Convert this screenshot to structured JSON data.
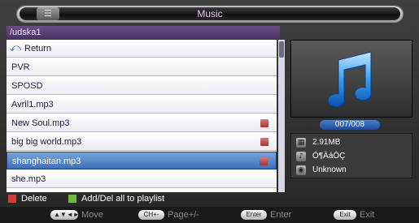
{
  "window": {
    "title": "Music",
    "menu_icon": "menu-icon"
  },
  "path": "/udska1",
  "files": [
    {
      "label": "Return",
      "icon": "return-icon"
    },
    {
      "label": "PVR"
    },
    {
      "label": "SPOSD"
    },
    {
      "label": "Avril1.mp3"
    },
    {
      "label": "New Soul.mp3",
      "marked": true
    },
    {
      "label": "big big world.mp3",
      "marked": true
    },
    {
      "label": "shanghaitan.mp3",
      "marked": true,
      "selected": true
    },
    {
      "label": "she.mp3"
    }
  ],
  "preview": {
    "icon": "music-note-icon",
    "counter": "007/008"
  },
  "info": {
    "size": "2.91MB",
    "artist": "Ó¶ÀáÒÇ",
    "album": "Unknown"
  },
  "legend": {
    "red_label": "Delete",
    "green_label": "Add/Del all to playlist",
    "red_color": "#d83a3a",
    "green_color": "#6dbb3a"
  },
  "hints": [
    {
      "key": "▲▼◄►",
      "label": "Move"
    },
    {
      "key": "CH+-",
      "label": "Page+/-"
    },
    {
      "key": "Enter",
      "label": "Enter"
    },
    {
      "key": "Exit",
      "label": "Exit"
    }
  ]
}
